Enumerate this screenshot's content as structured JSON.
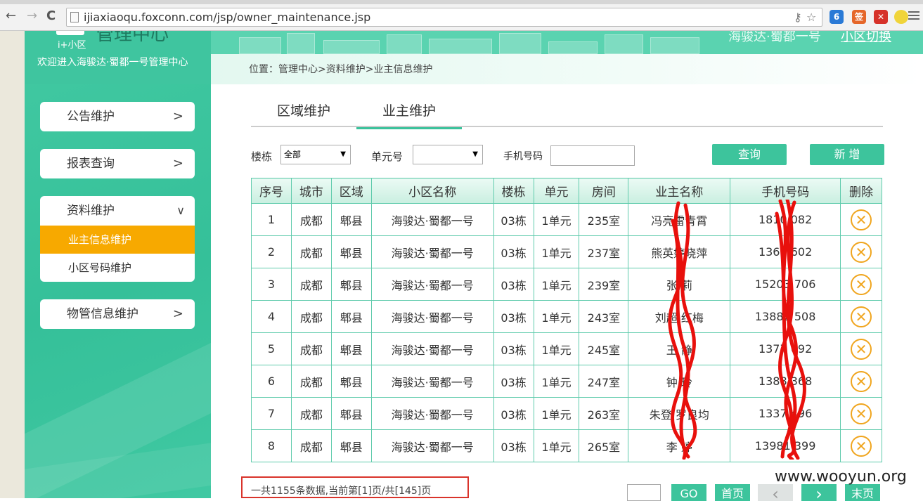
{
  "browser": {
    "url": "ijiaxiaoqu.foxconn.com/jsp/owner_maintenance.jsp",
    "back": "←",
    "forward": "→",
    "reload": "C"
  },
  "sidebar": {
    "logo_text": "管理中心",
    "logo_sub": "i+小区",
    "welcome": "欢迎进入海骏达·蜀都一号管理中心",
    "menu": [
      {
        "label": "公告维护"
      },
      {
        "label": "报表查询"
      },
      {
        "label": "资料维护"
      },
      {
        "label": "物管信息维护"
      }
    ],
    "submenu": [
      {
        "label": "业主信息维护"
      },
      {
        "label": "小区号码维护"
      }
    ]
  },
  "header": {
    "community": "海骏达·蜀都一号",
    "switch_link": "小区切换",
    "breadcrumb": "位置：管理中心>资料维护>业主信息维护"
  },
  "tabs": [
    {
      "label": "区域维护"
    },
    {
      "label": "业主维护"
    }
  ],
  "filter": {
    "building_label": "楼栋",
    "building_value": "全部",
    "unit_label": "单元号",
    "unit_value": "",
    "phone_label": "手机号码",
    "query_button": "查询",
    "add_button": "新 增"
  },
  "table": {
    "headers": [
      "序号",
      "城市",
      "区域",
      "小区名称",
      "楼栋",
      "单元",
      "房间",
      "业主名称",
      "手机号码",
      "删除"
    ],
    "rows": [
      {
        "no": "1",
        "city": "成都",
        "area": "郫县",
        "community": "海骏达·蜀都一号",
        "building": "03栋",
        "unit": "1单元",
        "room": "235室",
        "owner": "冯亮雷青霄",
        "phone": "1810   082"
      },
      {
        "no": "2",
        "city": "成都",
        "area": "郫县",
        "community": "海骏达·蜀都一号",
        "building": "03栋",
        "unit": "1单元",
        "room": "237室",
        "owner": "熊英婷晓萍",
        "phone": "1367   602"
      },
      {
        "no": "3",
        "city": "成都",
        "area": "郫县",
        "community": "海骏达·蜀都一号",
        "building": "03栋",
        "unit": "1单元",
        "room": "239室",
        "owner": "张   莉",
        "phone": "15203   706"
      },
      {
        "no": "4",
        "city": "成都",
        "area": "郫县",
        "community": "海骏达·蜀都一号",
        "building": "03栋",
        "unit": "1单元",
        "room": "243室",
        "owner": "刘超   红梅",
        "phone": "13882   508"
      },
      {
        "no": "5",
        "city": "成都",
        "area": "郫县",
        "community": "海骏达·蜀都一号",
        "building": "03栋",
        "unit": "1单元",
        "room": "245室",
        "owner": "王   静",
        "phone": "1377   692"
      },
      {
        "no": "6",
        "city": "成都",
        "area": "郫县",
        "community": "海骏达·蜀都一号",
        "building": "03栋",
        "unit": "1单元",
        "room": "247室",
        "owner": "钟   玲",
        "phone": "1388   368"
      },
      {
        "no": "7",
        "city": "成都",
        "area": "郫县",
        "community": "海骏达·蜀都一号",
        "building": "03栋",
        "unit": "1单元",
        "room": "263室",
        "owner": "朱登   罗良均",
        "phone": "1337   496"
      },
      {
        "no": "8",
        "city": "成都",
        "area": "郫县",
        "community": "海骏达·蜀都一号",
        "building": "03栋",
        "unit": "1单元",
        "room": "265室",
        "owner": "李   婷",
        "phone": "13981   399"
      }
    ],
    "delete_icon": "✕"
  },
  "pager": {
    "info": "一共1155条数据,当前第[1]页/共[145]页",
    "go": "GO",
    "first": "首页",
    "prev": "‹",
    "next": "›",
    "last": "末页"
  },
  "watermark": "www.wooyun.org"
}
